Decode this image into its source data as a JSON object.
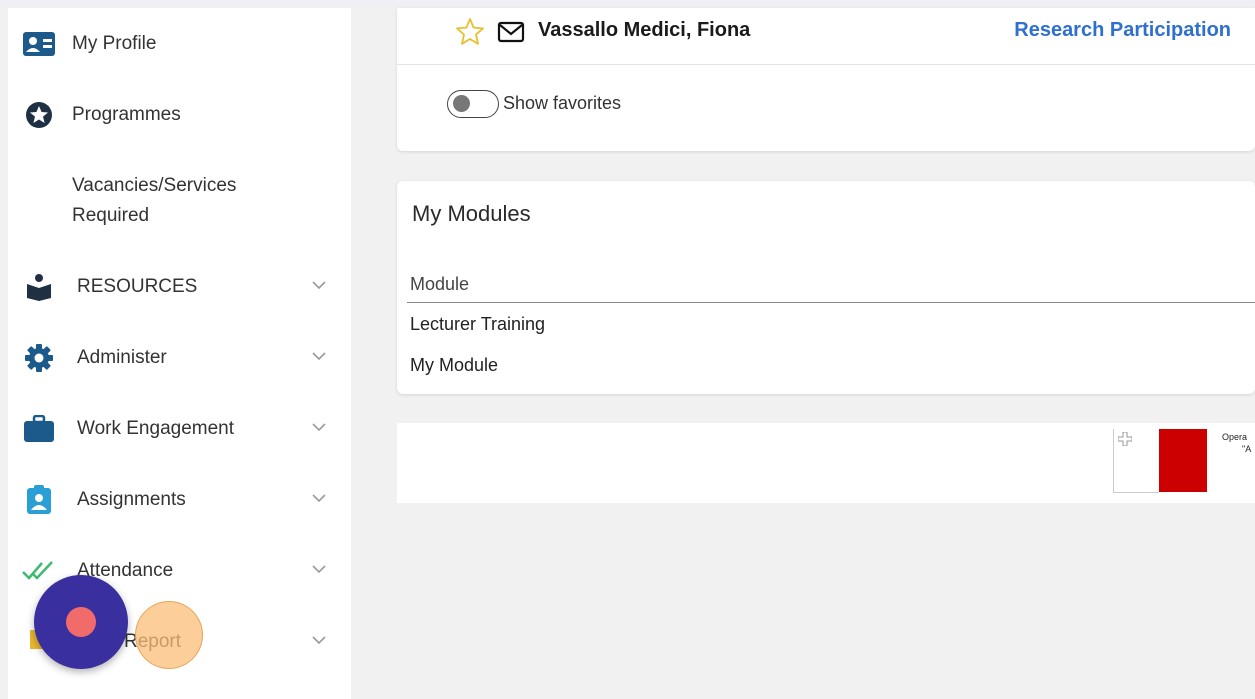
{
  "sidebar": {
    "items": [
      {
        "label": "My Profile",
        "icon": "id-card-icon"
      },
      {
        "label": "Programmes",
        "icon": "star-circle-icon"
      },
      {
        "label": "Vacancies/Services Required"
      },
      {
        "label": "RESOURCES",
        "icon": "reader-icon",
        "expandable": true
      },
      {
        "label": "Administer",
        "icon": "gear-icon",
        "expandable": true
      },
      {
        "label": "Work Engagement",
        "icon": "briefcase-icon",
        "expandable": true
      },
      {
        "label": "Assignments",
        "icon": "clipboard-user-icon",
        "expandable": true
      },
      {
        "label": "Attendance",
        "icon": "double-check-icon",
        "expandable": true
      },
      {
        "label": "Report",
        "icon": "flag-icon",
        "expandable": true
      }
    ]
  },
  "header_card": {
    "person_name": "Vassallo Medici, Fiona",
    "research_link": "Research Participation",
    "toggle_label": "Show favorites"
  },
  "modules": {
    "title": "My Modules",
    "column_header": "Module",
    "rows": [
      "Lecturer Training",
      "My Module"
    ]
  },
  "footer_banner": {
    "text_line1": "Opera",
    "text_line2": "\"A"
  },
  "colors": {
    "accent_link": "#2f6fd0",
    "icon_blue": "#1d5a8c",
    "record_button": "#3a2f9e",
    "record_dot": "#f26b6b",
    "flag_red": "#cc0000"
  }
}
